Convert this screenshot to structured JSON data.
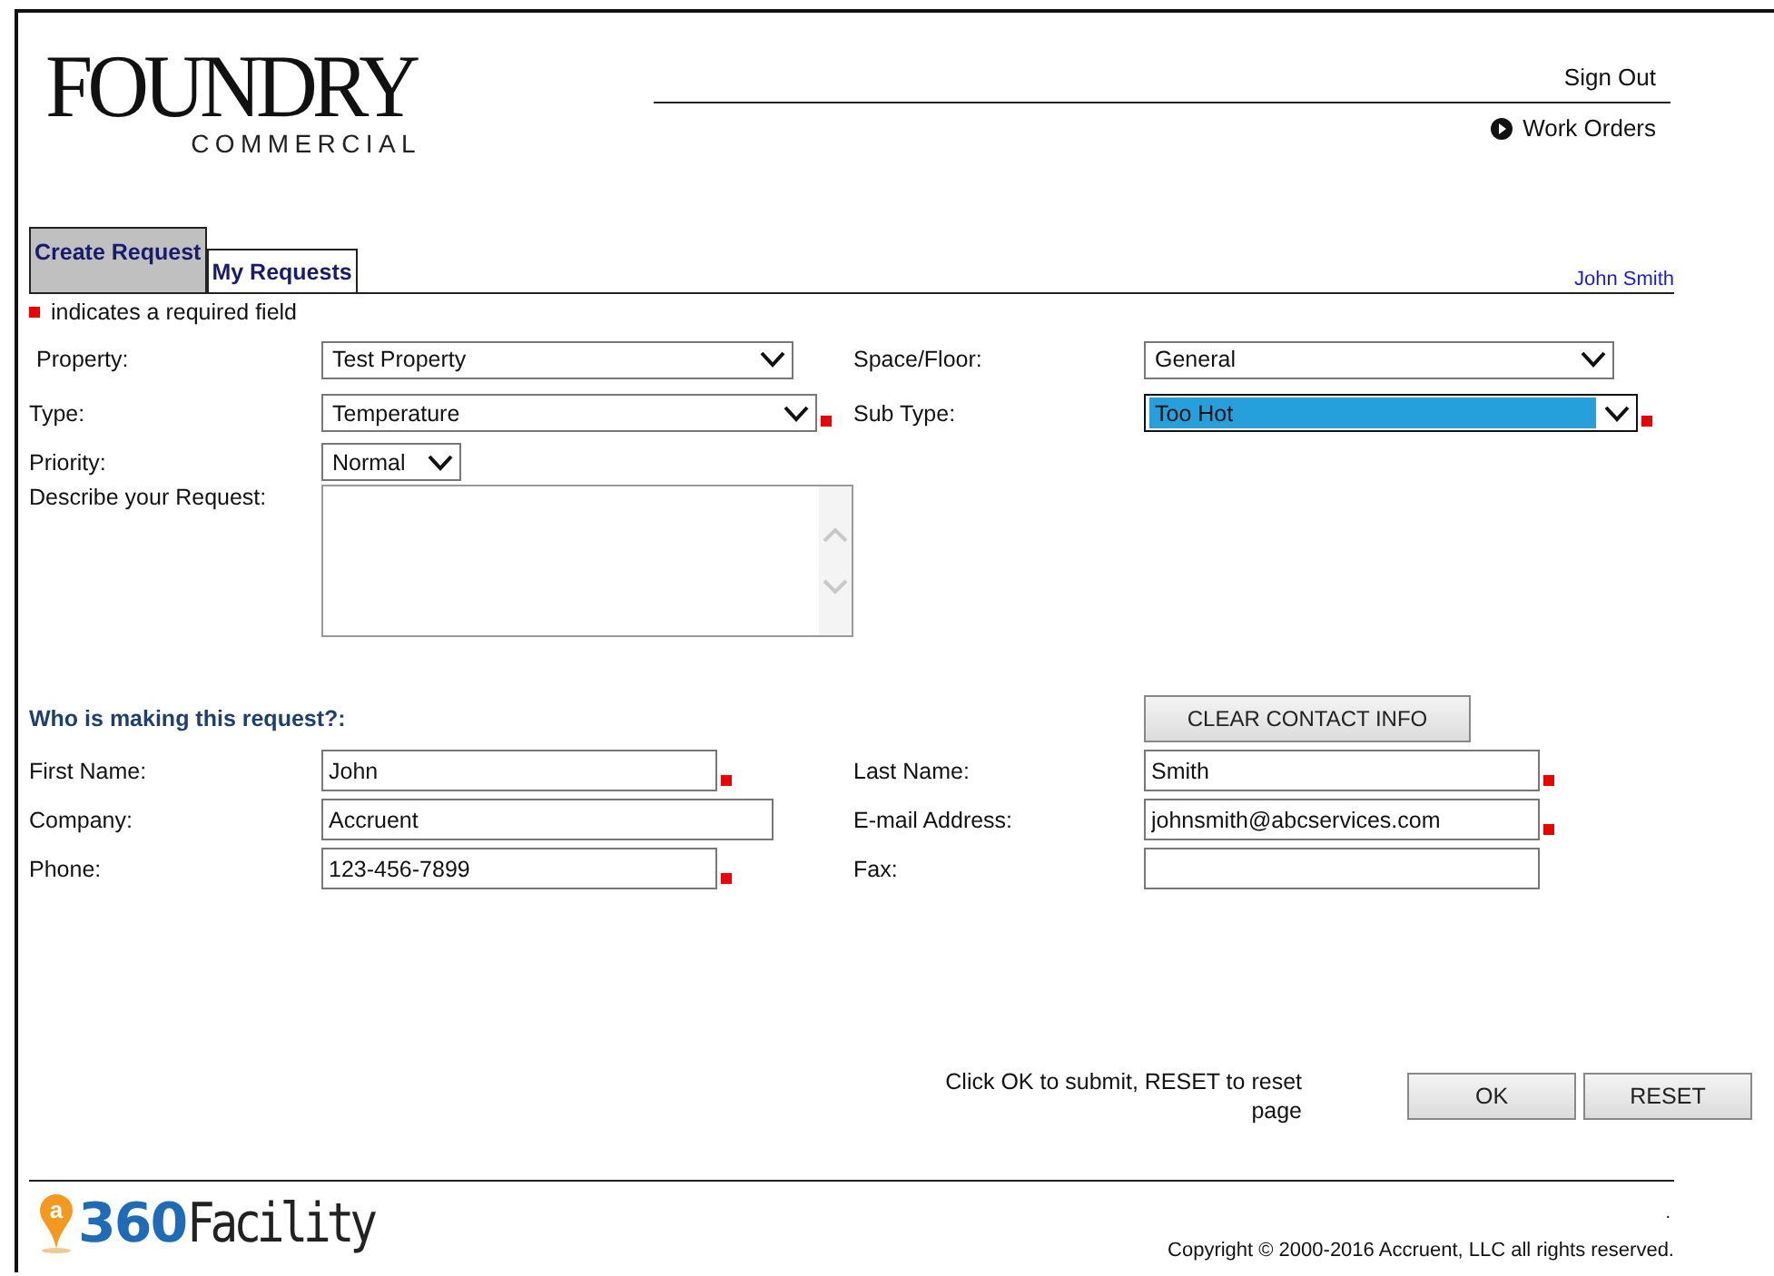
{
  "header": {
    "logo": {
      "name": "FOUNDRY",
      "sub": "COMMERCIAL"
    },
    "links": [
      {
        "label": "Sign Out",
        "kind": "plain"
      },
      {
        "label": "Work Orders",
        "kind": "arrow"
      }
    ]
  },
  "tabs": [
    {
      "label": "Create Request",
      "selected": true
    },
    {
      "label": "My Requests",
      "selected": false
    }
  ],
  "user": "John Smith",
  "required_note": "indicates a required field",
  "request_rows": [
    [
      {
        "label": "Property:",
        "kind": "select",
        "value": "Test Property",
        "required": false,
        "highlighted": false
      },
      {
        "label": "Space/Floor:",
        "kind": "select",
        "value": "General",
        "required": false,
        "highlighted": false
      }
    ],
    [
      {
        "label": "Type:",
        "kind": "select",
        "value": "Temperature",
        "required": true,
        "highlighted": false
      },
      {
        "label": "Sub Type:",
        "kind": "select",
        "value": "Too Hot",
        "required": true,
        "highlighted": true
      }
    ],
    [
      {
        "label": "Priority:",
        "kind": "select",
        "value": "Normal",
        "required": false,
        "highlighted": false
      }
    ],
    [
      {
        "label": "Describe your Request:",
        "kind": "textarea",
        "required": false
      }
    ]
  ],
  "contact": {
    "heading": "Who is making this request?:",
    "clear_button": "CLEAR CONTACT INFO",
    "rows": [
      [
        {
          "label": "First Name:",
          "kind": "text",
          "value": "John",
          "required": true
        },
        {
          "label": "Last Name:",
          "kind": "text",
          "value": "Smith",
          "required": true
        }
      ],
      [
        {
          "label": "Company:",
          "kind": "text",
          "value": "Accruent",
          "required": false
        },
        {
          "label": "E-mail Address:",
          "kind": "text",
          "value": "johnsmith@abcservices.com",
          "required": true
        }
      ],
      [
        {
          "label": "Phone:",
          "kind": "text",
          "value": "123-456-7899",
          "required": true
        },
        {
          "label": "Fax:",
          "kind": "text",
          "required": false
        }
      ]
    ]
  },
  "submit": {
    "hint": "Click OK to submit, RESET to reset page",
    "buttons": [
      "OK",
      "RESET"
    ]
  },
  "footer": {
    "logo": {
      "mark": "a",
      "number": "360",
      "name": "Facility"
    },
    "dot": ".",
    "copyright": "Copyright © 2000-2016 Accruent, LLC all rights reserved."
  }
}
